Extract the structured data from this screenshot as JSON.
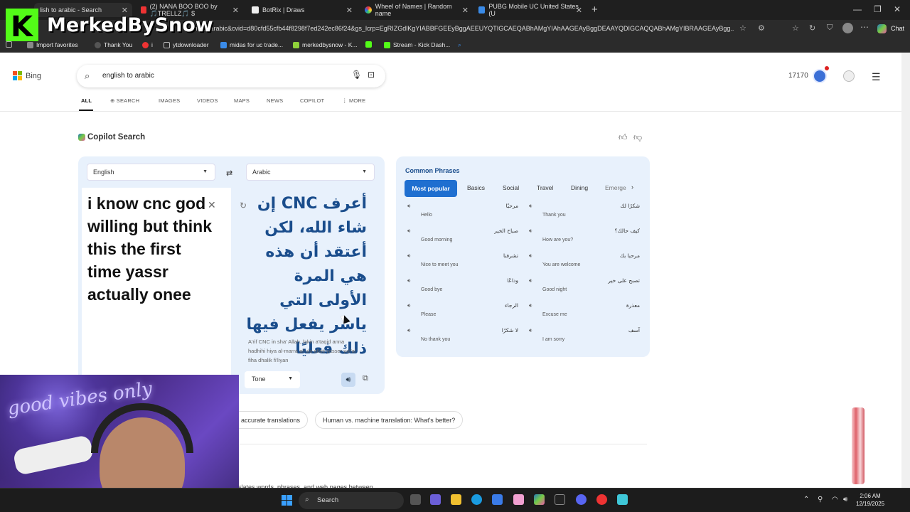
{
  "browser": {
    "tabs": [
      {
        "title": "lish to arabic - Search"
      },
      {
        "title": "(2) NANA BOO BOO by 🎵TRELLZ🎵 $"
      },
      {
        "title": "BotRix | Draws"
      },
      {
        "title": "Wheel of Names | Random name"
      },
      {
        "title": "PUBG Mobile UC United States (U"
      }
    ],
    "url": "sh+to+arabic&cvid=d80cfd55cfb44f8298f7ed242ec86f24&gs_lcrp=EgRIZGdlKgYIABBFGEEyBggAEEUYQTIGCAEQABhAMgYIAhAAGEAyBggDEAAYQDIGCAQQABhAMgYIBRAAGEAyBgg...",
    "chat_label": "Chat",
    "favorites": [
      {
        "label": "Import favorites",
        "color": "#888"
      },
      {
        "label": "Thank You",
        "color": "#333"
      },
      {
        "label": "i",
        "color": "#e33"
      },
      {
        "label": "ytdownloader",
        "color": "#999"
      },
      {
        "label": "midas for uc trade...",
        "color": "#3a8be8"
      },
      {
        "label": "merkedbysnow - K...",
        "color": "#8fd13a"
      },
      {
        "label": "",
        "color": "#53fc18"
      },
      {
        "label": "Stream - Kick Dash...",
        "color": "#53fc18"
      }
    ]
  },
  "bing": {
    "logo_text": "Bing",
    "query": "english to arabic",
    "points": "17170",
    "nav": [
      "ALL",
      "SEARCH",
      "IMAGES",
      "VIDEOS",
      "MAPS",
      "NEWS",
      "COPILOT",
      "MORE"
    ],
    "copilot_title": "Copilot Search"
  },
  "translator": {
    "source_lang": "English",
    "target_lang": "Arabic",
    "source_text": "i know cnc god willing but think this the first time yassr actually onee",
    "translated_text": "أعرف CNC إن شاء الله، لكن أعتقد أن هذه هي المرة الأولى التي ياسر يفعل فيها ذلك فعليًا",
    "transliteration": "A'rif CNC in sha' Allah, lakin a'taqid anna hadhihi hiya al-marra al-ula allati yasser yaf'al fiha dhalik fi'liyan",
    "tone_label": "Tone"
  },
  "phrases": {
    "title": "Common Phrases",
    "tabs": [
      "Most popular",
      "Basics",
      "Social",
      "Travel",
      "Dining",
      "Emerge"
    ],
    "items": [
      {
        "ar": "مرحبًا",
        "en": "Hello"
      },
      {
        "ar": "شكرًا لك",
        "en": "Thank you"
      },
      {
        "ar": "صباح الخير",
        "en": "Good morning"
      },
      {
        "ar": "كيف حالك؟",
        "en": "How are you?"
      },
      {
        "ar": "تشرفنا",
        "en": "Nice to meet you"
      },
      {
        "ar": "مرحبا بك",
        "en": "You are welcome"
      },
      {
        "ar": "وداعًا",
        "en": "Good bye"
      },
      {
        "ar": "تصبح على خير",
        "en": "Good night"
      },
      {
        "ar": "الرجاء",
        "en": "Please"
      },
      {
        "ar": "معذرة",
        "en": "Excuse me"
      },
      {
        "ar": "لا شكرًا",
        "en": "No thank you"
      },
      {
        "ar": "آسف",
        "en": "I am sorry"
      }
    ]
  },
  "chips": [
    "accurate translations",
    "Human vs. machine translation: What's better?"
  ],
  "cut_text": "slates words, phrases, and web pages between",
  "overlay": {
    "streamer_name": "MerkedBySnow",
    "k_letter": "K",
    "neon_sign": "good vibes only"
  },
  "taskbar": {
    "search_label": "Search",
    "time": "2:06 AM",
    "date": "12/19/2025"
  }
}
